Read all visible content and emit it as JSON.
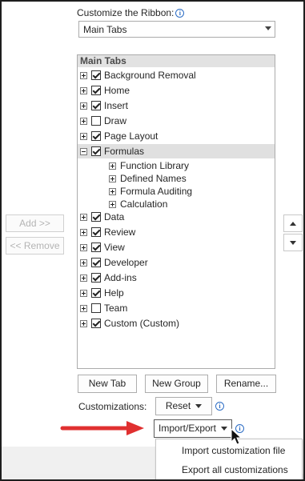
{
  "customize_label": "Customize the Ribbon:",
  "tabs_dropdown": {
    "value": "Main Tabs"
  },
  "tree": {
    "header": "Main Tabs",
    "items": [
      {
        "label": "Background Removal",
        "checked": true,
        "expanded": false,
        "level": 0
      },
      {
        "label": "Home",
        "checked": true,
        "expanded": false,
        "level": 0
      },
      {
        "label": "Insert",
        "checked": true,
        "expanded": false,
        "level": 0
      },
      {
        "label": "Draw",
        "checked": false,
        "expanded": false,
        "level": 0
      },
      {
        "label": "Page Layout",
        "checked": true,
        "expanded": false,
        "level": 0
      },
      {
        "label": "Formulas",
        "checked": true,
        "expanded": true,
        "level": 0,
        "selected": true
      },
      {
        "label": "Function Library",
        "level": 1
      },
      {
        "label": "Defined Names",
        "level": 1
      },
      {
        "label": "Formula Auditing",
        "level": 1
      },
      {
        "label": "Calculation",
        "level": 1
      },
      {
        "label": "Data",
        "checked": true,
        "expanded": false,
        "level": 0
      },
      {
        "label": "Review",
        "checked": true,
        "expanded": false,
        "level": 0
      },
      {
        "label": "View",
        "checked": true,
        "expanded": false,
        "level": 0
      },
      {
        "label": "Developer",
        "checked": true,
        "expanded": false,
        "level": 0
      },
      {
        "label": "Add-ins",
        "checked": true,
        "expanded": false,
        "level": 0
      },
      {
        "label": "Help",
        "checked": true,
        "expanded": false,
        "level": 0
      },
      {
        "label": "Team",
        "checked": false,
        "expanded": false,
        "level": 0
      },
      {
        "label": "Custom (Custom)",
        "checked": true,
        "expanded": false,
        "level": 0
      }
    ]
  },
  "buttons": {
    "add": "Add >>",
    "remove": "<< Remove",
    "new_tab": "New Tab",
    "new_group": "New Group",
    "rename": "Rename...",
    "reset": "Reset",
    "import_export": "Import/Export"
  },
  "customizations_label": "Customizations:",
  "import_export_menu": {
    "items": [
      "Import customization file",
      "Export all customizations"
    ]
  },
  "colors": {
    "annotation_arrow": "#e03030",
    "info_icon": "#2b6cc4"
  },
  "icons": {
    "info": "info-icon",
    "mouse_cursor": "mouse-pointer-icon"
  }
}
